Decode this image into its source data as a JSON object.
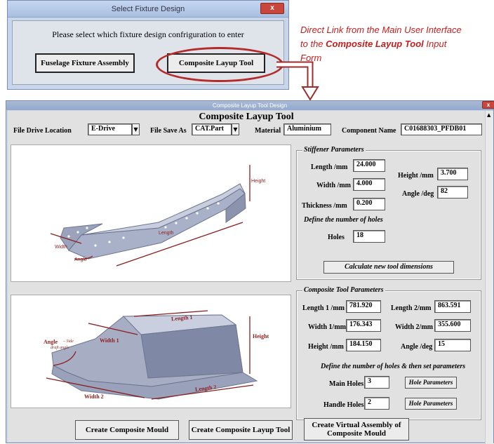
{
  "dialog1": {
    "title": "Select Fixture Design",
    "close": "x",
    "prompt": "Please select which fixture design confriguration to enter",
    "btn_fuselage": "Fuselage Fixture Assembly",
    "btn_composite": "Composite Layup Tool"
  },
  "annotation": {
    "line1": "Direct Link from the Main User Interface",
    "line2_pre": "to the ",
    "line2_bold": "Composite Layup Tool",
    "line2_post": " Input",
    "line3": "Form"
  },
  "dialog2": {
    "title": "Composite Layup Tool Design",
    "close": "x",
    "heading": "Composite Layup Tool",
    "file_drive_label": "File Drive Location",
    "file_drive_value": "E-Drive",
    "file_save_label": "File Save As",
    "file_save_value": "CAT.Part",
    "material_label": "Material",
    "material_value": "Aluminium",
    "component_label": "Component Name",
    "component_value": "C01688303_PFDB01",
    "stiffener": {
      "title": "Stiffener Parameters",
      "length_label": "Length /mm",
      "length_value": "24.000",
      "width_label": "Width /mm",
      "width_value": "4.000",
      "thickness_label": "Thickness /mm",
      "thickness_value": "0.200",
      "height_label": "Height /mm",
      "height_value": "3.700",
      "angle_label": "Angle /deg",
      "angle_value": "82",
      "holes_define": "Define the number of holes",
      "holes_label": "Holes",
      "holes_value": "18",
      "calc_button": "Calculate new tool dimensions"
    },
    "tool": {
      "title": "Composite Tool Parameters",
      "length1_label": "Length 1 /mm",
      "length1_value": "781.920",
      "length2_label": "Length 2/mm",
      "length2_value": "863.591",
      "width1_label": "Width 1/mm",
      "width1_value": "176.343",
      "width2_label": "Width 2/mm",
      "width2_value": "355.600",
      "height_label": "Height /mm",
      "height_value": "184.150",
      "angle_label": "Angle /deg",
      "angle_value": "15",
      "holes_define": "Define the number of holes & then set parameters",
      "main_holes_label": "Main Holes",
      "main_holes_value": "3",
      "handle_holes_label": "Handle Holes",
      "handle_holes_value": "2",
      "hole_params_button": "Hole Parameters"
    },
    "img1_labels": {
      "height": "Height",
      "length": "Length",
      "width": "Width",
      "angle": "Angle"
    },
    "img2_labels": {
      "angle": "Angle",
      "side": "– Side",
      "draft": "draft angle",
      "width1": "Width 1",
      "length1": "Length 1",
      "height": "Height",
      "width2": "Width 2",
      "length2": "Length 2"
    },
    "buttons": {
      "create_mould": "Create Composite Mould",
      "create_layup": "Create Composite Layup Tool",
      "create_virtual_1": "Create Virtual Assembly of",
      "create_virtual_2": "Composite Mould"
    }
  }
}
